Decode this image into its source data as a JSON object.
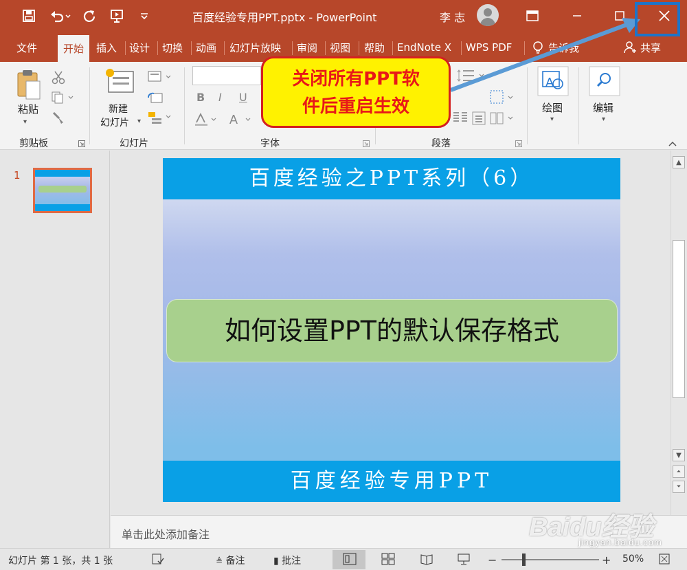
{
  "window": {
    "title": "百度经验专用PPT.pptx  -  PowerPoint",
    "user": "李 志"
  },
  "tabs": [
    {
      "label": "文件"
    },
    {
      "label": "开始"
    },
    {
      "label": "插入"
    },
    {
      "label": "设计"
    },
    {
      "label": "切换"
    },
    {
      "label": "动画"
    },
    {
      "label": "幻灯片放映"
    },
    {
      "label": "审阅"
    },
    {
      "label": "视图"
    },
    {
      "label": "帮助"
    },
    {
      "label": "EndNote X"
    },
    {
      "label": "WPS PDF"
    },
    {
      "label": "告诉我"
    },
    {
      "label": "共享"
    }
  ],
  "ribbon": {
    "paste": "粘贴",
    "new_slide": [
      "新建",
      "幻灯片"
    ],
    "drawing": "绘图",
    "editing": "编辑",
    "groups": {
      "clipboard": "剪贴板",
      "slides": "幻灯片",
      "font": "字体",
      "paragraph": "段落"
    },
    "font_buttons": [
      "B",
      "I",
      "U",
      "S"
    ]
  },
  "callout": {
    "line1": "关闭所有PPT软",
    "line2": "件后重启生效"
  },
  "thumbnail": {
    "number": "1"
  },
  "slide": {
    "header": "百度经验之PPT系列（6）",
    "main": "如何设置PPT的默认保存格式",
    "footer": "百度经验专用PPT"
  },
  "notes": {
    "placeholder": "单击此处添加备注"
  },
  "status": {
    "slide_info": "幻灯片 第 1 张，共 1 张",
    "notes_btn": "备注",
    "comments_btn": "批注",
    "zoom": "50%"
  },
  "watermark": {
    "brand": "Baidu经验",
    "url": "jingyan.baidu.com"
  },
  "colors": {
    "accent": "#b7472a",
    "slide_band": "#09a0e6",
    "title_box": "#a8d08d",
    "callout_fill": "#fff200",
    "callout_text": "#e81818",
    "arrow": "#5b9bd5"
  }
}
